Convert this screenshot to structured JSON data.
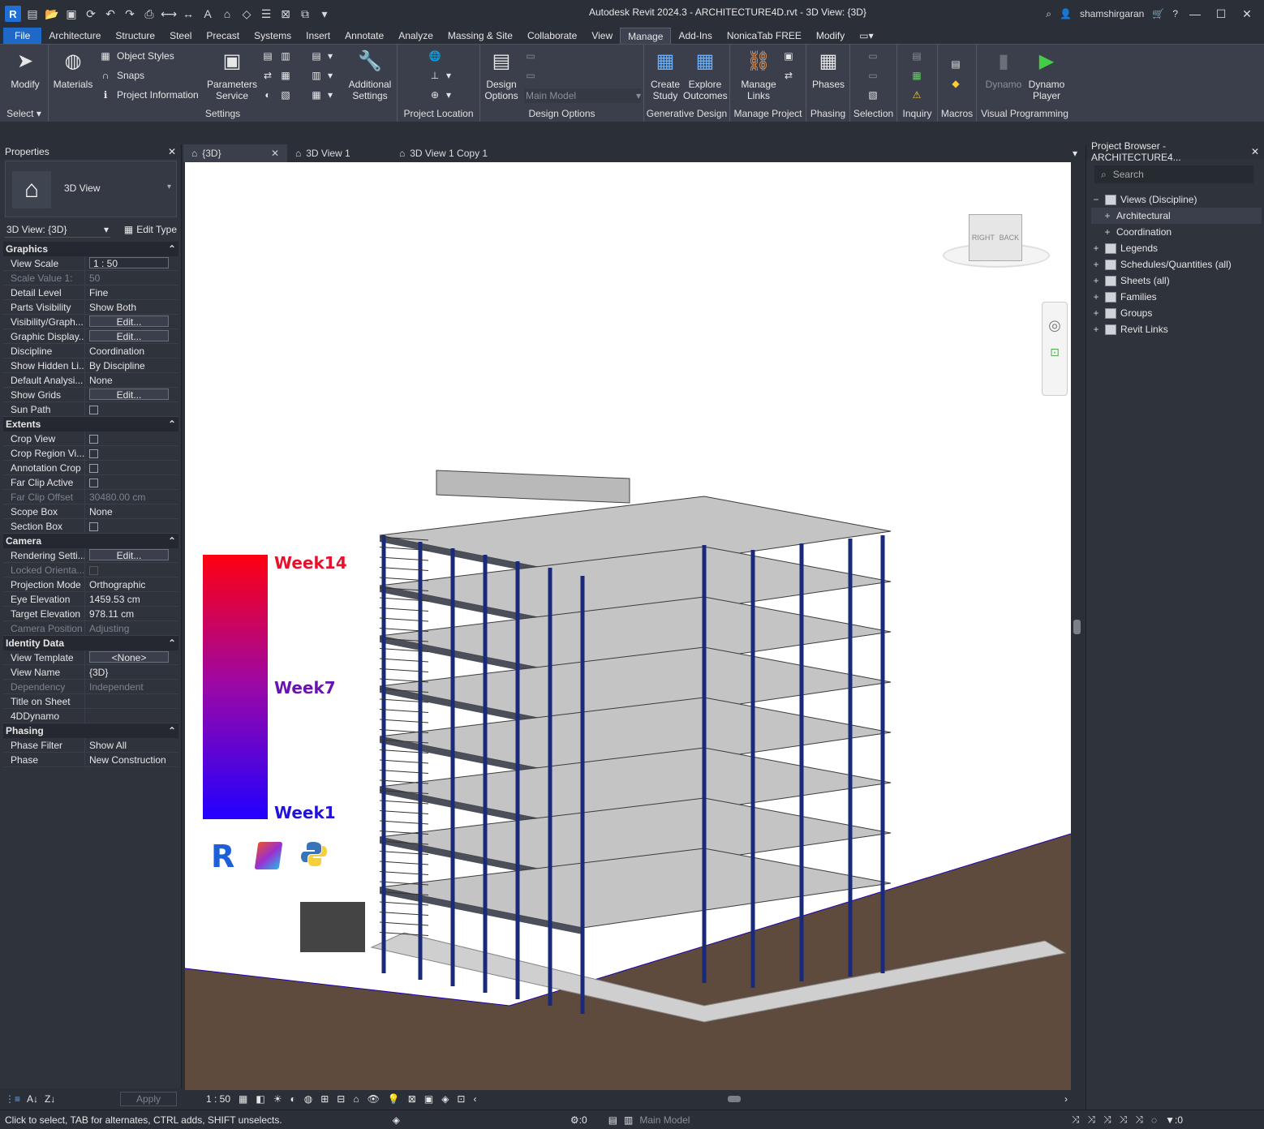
{
  "title": "Autodesk Revit 2024.3 - ARCHITECTURE4D.rvt - 3D View: {3D}",
  "user": "shamshirgaran",
  "menu": [
    "File",
    "Architecture",
    "Structure",
    "Steel",
    "Precast",
    "Systems",
    "Insert",
    "Annotate",
    "Analyze",
    "Massing & Site",
    "Collaborate",
    "View",
    "Manage",
    "Add-Ins",
    "NonicaTab FREE",
    "Modify"
  ],
  "active_menu": "Manage",
  "ribbon": {
    "modify": "Modify",
    "select": "Select",
    "materials": "Materials",
    "object_styles": "Object Styles",
    "snaps": "Snaps",
    "project_information": "Project Information",
    "parameters_service": "Parameters Service",
    "additional_settings": "Additional Settings",
    "settings": "Settings",
    "project_location": "Project Location",
    "design_options": "Design Options",
    "main_model": "Main Model",
    "design_options_group": "Design Options",
    "create_study": "Create Study",
    "explore_outcomes": "Explore Outcomes",
    "generative_design": "Generative Design",
    "manage_links": "Manage Links",
    "manage_project": "Manage Project",
    "phases": "Phases",
    "phasing": "Phasing",
    "selection": "Selection",
    "inquiry": "Inquiry",
    "macros": "Macros",
    "dynamo": "Dynamo",
    "dynamo_player": "Dynamo Player",
    "visual_programming": "Visual Programming"
  },
  "properties": {
    "header": "Properties",
    "type_name": "3D View",
    "view_selector": "3D View: {3D}",
    "edit_type": "Edit Type",
    "apply": "Apply",
    "sections": [
      {
        "name": "Graphics",
        "rows": [
          {
            "name": "View Scale",
            "value": "1 : 50",
            "kind": "boxed"
          },
          {
            "name": "Scale Value    1:",
            "value": "50",
            "kind": "dis"
          },
          {
            "name": "Detail Level",
            "value": "Fine"
          },
          {
            "name": "Parts Visibility",
            "value": "Show Both"
          },
          {
            "name": "Visibility/Graph...",
            "value": "Edit...",
            "kind": "btn"
          },
          {
            "name": "Graphic Display...",
            "value": "Edit...",
            "kind": "btn"
          },
          {
            "name": "Discipline",
            "value": "Coordination"
          },
          {
            "name": "Show Hidden Li...",
            "value": "By Discipline"
          },
          {
            "name": "Default Analysi...",
            "value": "None"
          },
          {
            "name": "Show Grids",
            "value": "Edit...",
            "kind": "btn"
          },
          {
            "name": "Sun Path",
            "value": "",
            "kind": "chk"
          }
        ]
      },
      {
        "name": "Extents",
        "rows": [
          {
            "name": "Crop View",
            "value": "",
            "kind": "chk"
          },
          {
            "name": "Crop Region Vi...",
            "value": "",
            "kind": "chk"
          },
          {
            "name": "Annotation Crop",
            "value": "",
            "kind": "chk"
          },
          {
            "name": "Far Clip Active",
            "value": "",
            "kind": "chk"
          },
          {
            "name": "Far Clip Offset",
            "value": "30480.00 cm",
            "kind": "dis"
          },
          {
            "name": "Scope Box",
            "value": "None"
          },
          {
            "name": "Section Box",
            "value": "",
            "kind": "chk"
          }
        ]
      },
      {
        "name": "Camera",
        "rows": [
          {
            "name": "Rendering Setti...",
            "value": "Edit...",
            "kind": "btn"
          },
          {
            "name": "Locked Orienta...",
            "value": "",
            "kind": "dischk"
          },
          {
            "name": "Projection Mode",
            "value": "Orthographic"
          },
          {
            "name": "Eye Elevation",
            "value": "1459.53 cm"
          },
          {
            "name": "Target Elevation",
            "value": "978.11 cm"
          },
          {
            "name": "Camera Position",
            "value": "Adjusting",
            "kind": "dis"
          }
        ]
      },
      {
        "name": "Identity Data",
        "rows": [
          {
            "name": "View Template",
            "value": "<None>",
            "kind": "btn"
          },
          {
            "name": "View Name",
            "value": "{3D}"
          },
          {
            "name": "Dependency",
            "value": "Independent",
            "kind": "dis"
          },
          {
            "name": "Title on Sheet",
            "value": ""
          },
          {
            "name": "4DDynamo",
            "value": ""
          }
        ]
      },
      {
        "name": "Phasing",
        "rows": [
          {
            "name": "Phase Filter",
            "value": "Show All"
          },
          {
            "name": "Phase",
            "value": "New Construction"
          }
        ]
      }
    ]
  },
  "tabs": [
    "{3D}",
    "3D View 1",
    "3D View 1 Copy 1"
  ],
  "viewcube": {
    "right": "RIGHT",
    "back": "BACK"
  },
  "legend": {
    "top": "Week14",
    "mid": "Week7",
    "bottom": "Week1"
  },
  "view_scale": "1 : 50",
  "browser": {
    "header": "Project Browser - ARCHITECTURE4...",
    "search": "Search",
    "nodes": [
      {
        "label": "Views (Discipline)",
        "toggle": "−",
        "indent": 0
      },
      {
        "label": "Architectural",
        "toggle": "+",
        "indent": 1
      },
      {
        "label": "Coordination",
        "toggle": "+",
        "indent": 1
      },
      {
        "label": "Legends",
        "toggle": "+",
        "indent": 0
      },
      {
        "label": "Schedules/Quantities (all)",
        "toggle": "+",
        "indent": 0
      },
      {
        "label": "Sheets (all)",
        "toggle": "+",
        "indent": 0
      },
      {
        "label": "Families",
        "toggle": "+",
        "indent": 0
      },
      {
        "label": "Groups",
        "toggle": "+",
        "indent": 0
      },
      {
        "label": "Revit Links",
        "toggle": "+",
        "indent": 0
      }
    ]
  },
  "status": {
    "hint": "Click to select, TAB for alternates, CTRL adds, SHIFT unselects.",
    "worksets": ":0",
    "model": "Main Model",
    "filter": ":0"
  }
}
